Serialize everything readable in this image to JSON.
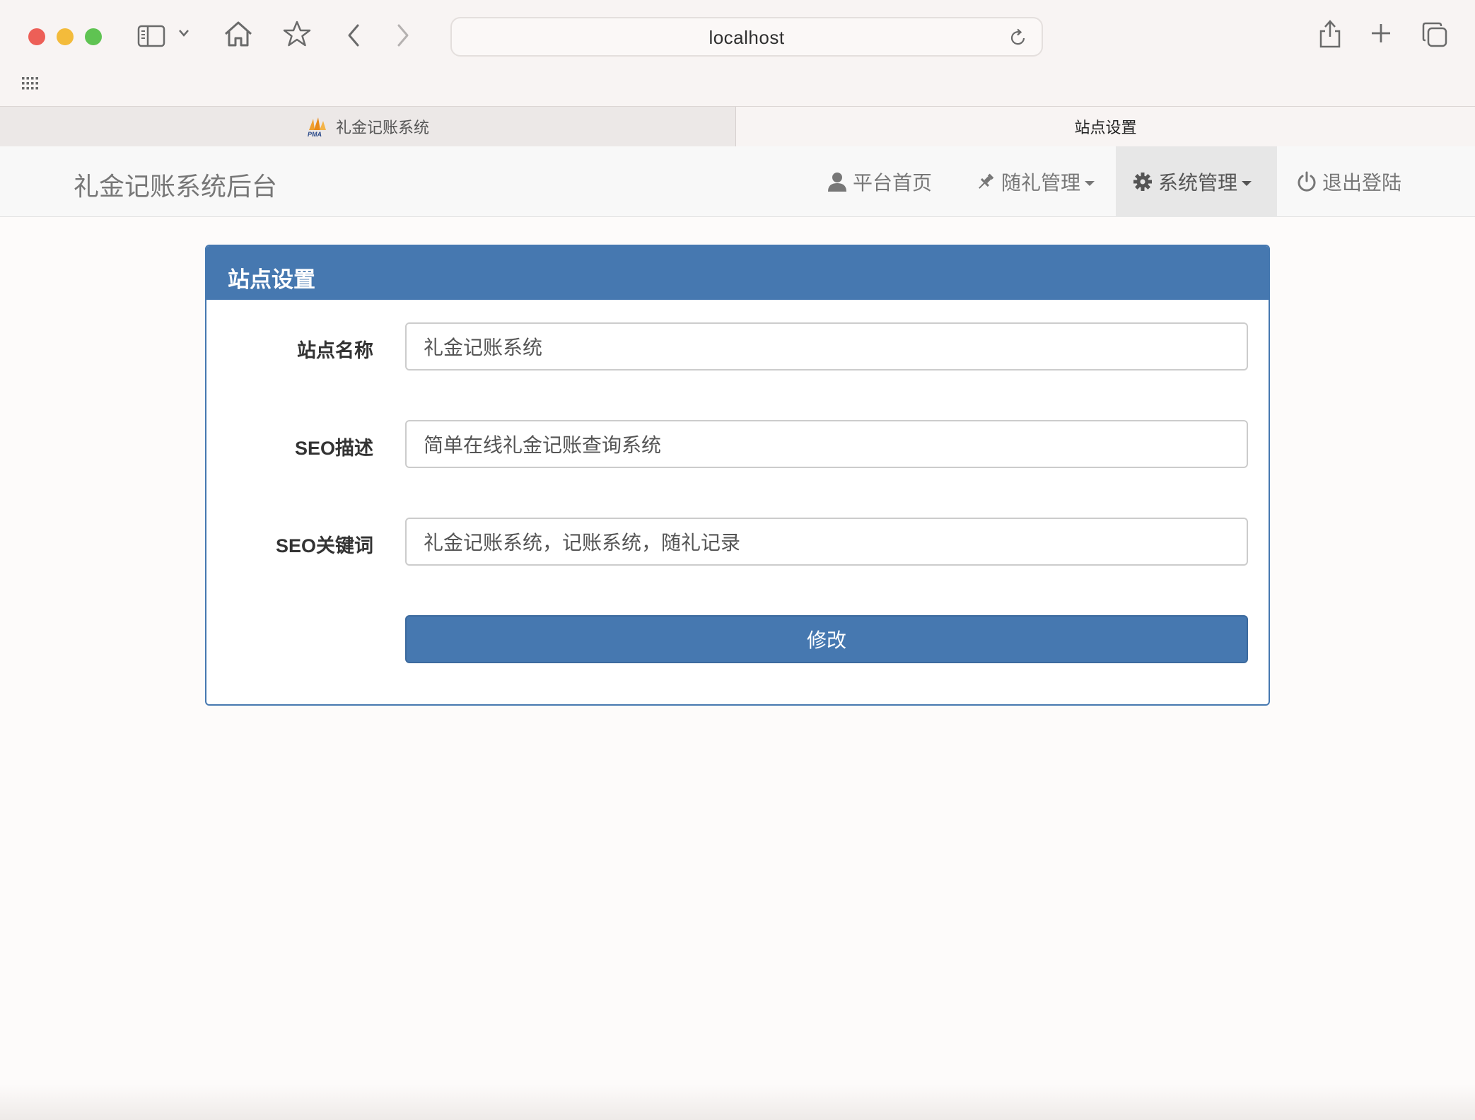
{
  "browser": {
    "url": "localhost",
    "tabs": [
      {
        "label": "礼金记账系统",
        "favicon": "pma-logo"
      },
      {
        "label": "站点设置"
      }
    ]
  },
  "navbar": {
    "brand": "礼金记账系统后台",
    "items": [
      {
        "label": "平台首页",
        "icon": "user-icon"
      },
      {
        "label": "随礼管理",
        "icon": "pushpin-icon",
        "dropdown": true
      },
      {
        "label": "系统管理",
        "icon": "gear-icon",
        "dropdown": true,
        "active": true
      },
      {
        "label": "退出登陆",
        "icon": "power-icon"
      }
    ]
  },
  "panel": {
    "title": "站点设置",
    "fields": [
      {
        "label": "站点名称",
        "value": "礼金记账系统"
      },
      {
        "label": "SEO描述",
        "value": "简单在线礼金记账查询系统"
      },
      {
        "label": "SEO关键词",
        "value": "礼金记账系统，记账系统，随礼记录"
      }
    ],
    "submit_label": "修改"
  },
  "colors": {
    "primary": "#4678b0",
    "navbar_bg": "#f8f8f8",
    "active_nav_bg": "#e7e7e7"
  }
}
